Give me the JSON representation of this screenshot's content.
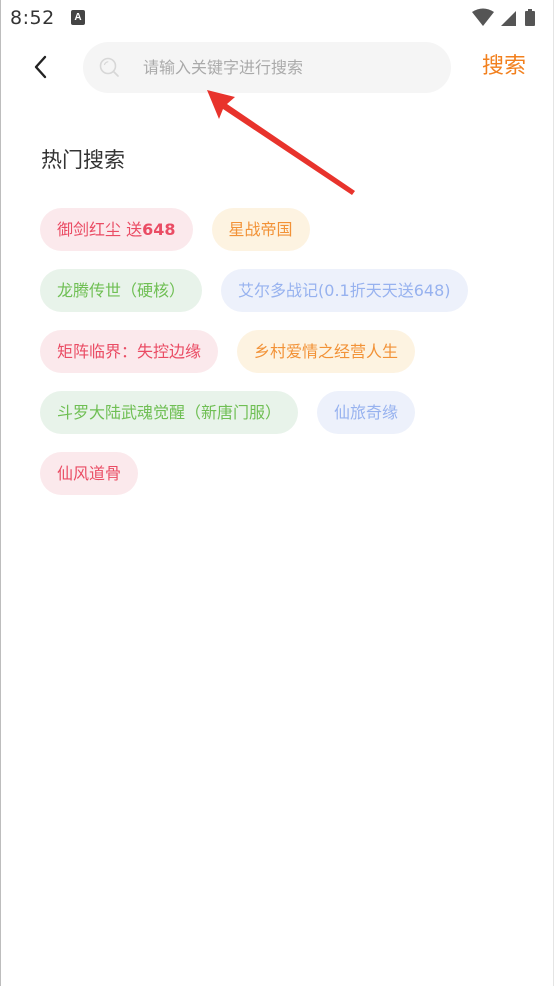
{
  "status_bar": {
    "time": "8:52",
    "notification_icon": "A"
  },
  "header": {
    "search_placeholder": "请输入关键字进行搜索",
    "search_value": "",
    "search_button_label": "搜索"
  },
  "hot_search": {
    "title": "热门搜索",
    "rows": [
      [
        {
          "label": "御剑红尘 送",
          "suffix": "648",
          "style": "red"
        },
        {
          "label": "星战帝国",
          "suffix": "",
          "style": "orange"
        }
      ],
      [
        {
          "label": "龙腾传世（硬核）",
          "suffix": "",
          "style": "green"
        },
        {
          "label": "艾尔多战记(0.1折天天送648)",
          "suffix": "",
          "style": "blue"
        }
      ],
      [
        {
          "label": "矩阵临界：失控边缘",
          "suffix": "",
          "style": "red"
        },
        {
          "label": "乡村爱情之经营人生",
          "suffix": "",
          "style": "orange"
        }
      ],
      [
        {
          "label": "斗罗大陆武魂觉醒（新唐门服）",
          "suffix": "",
          "style": "green"
        },
        {
          "label": "仙旅奇缘",
          "suffix": "",
          "style": "blue"
        }
      ],
      [
        {
          "label": "仙风道骨",
          "suffix": "",
          "style": "red"
        }
      ]
    ]
  },
  "colors": {
    "accent": "#f2801e",
    "annotation_arrow": "#e8332c",
    "tag_red_text": "#ea4c64",
    "tag_orange_text": "#f29237",
    "tag_green_text": "#6fbf54",
    "tag_blue_text": "#97b2ef"
  },
  "icons": {
    "back": "chevron-left-icon",
    "search": "search-icon",
    "wifi": "wifi-icon",
    "signal": "signal-icon",
    "battery": "battery-icon"
  }
}
